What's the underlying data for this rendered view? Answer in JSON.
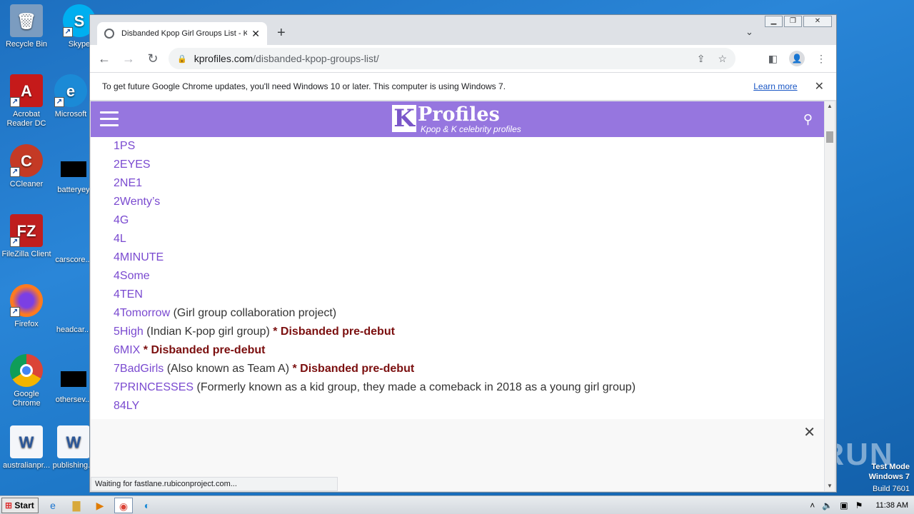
{
  "desktop": {
    "icons": [
      {
        "name": "recycle-bin",
        "label": "Recycle Bin",
        "glyph": "🗑",
        "color": "#6d8fb3"
      },
      {
        "name": "skype",
        "label": "Skype",
        "glyph": "S",
        "color": "#00aff0"
      },
      {
        "name": "acrobat",
        "label": "Acrobat Reader DC",
        "glyph": "A",
        "color": "#c51a1a"
      },
      {
        "name": "edge",
        "label": "Microsoft",
        "glyph": "e",
        "color": "#1b8ad6"
      },
      {
        "name": "ccleaner",
        "label": "CCleaner",
        "glyph": "C",
        "color": "#c43a25"
      },
      {
        "name": "batteryey",
        "label": "batteryey"
      },
      {
        "name": "filezilla",
        "label": "FileZilla Client",
        "glyph": "FZ",
        "color": "#bf1e1e"
      },
      {
        "name": "carscore",
        "label": "carscore..."
      },
      {
        "name": "firefox",
        "label": "Firefox",
        "glyph": "●",
        "color": "#ff7a1f"
      },
      {
        "name": "headcar",
        "label": "headcar..."
      },
      {
        "name": "chrome",
        "label": "Google Chrome",
        "glyph": "◉",
        "color": "#3b8a3e"
      },
      {
        "name": "othersev",
        "label": "othersev..."
      },
      {
        "name": "australianpr",
        "label": "australianpr...",
        "glyph": "W",
        "color": "#2b579a"
      },
      {
        "name": "publishing",
        "label": "publishing...",
        "glyph": "W",
        "color": "#2b579a"
      }
    ],
    "watermark": {
      "line1": "Test Mode",
      "line2": "Windows 7",
      "line3": "Build 7601",
      "brand": "ANY RUN"
    }
  },
  "browser": {
    "tab_title": "Disbanded Kpop Girl Groups List - Kp",
    "url_host": "kprofiles.com",
    "url_path": "/disbanded-kpop-groups-list/",
    "infobar_text": "To get future Google Chrome updates, you'll need Windows 10 or later. This computer is using Windows 7.",
    "infobar_link": "Learn more",
    "status_text": "Waiting for fastlane.rubiconproject.com..."
  },
  "site": {
    "logo_k": "K",
    "logo_name": "Profiles",
    "logo_tagline": "Kpop & K celebrity profiles",
    "header_color": "#9676df",
    "groups": [
      {
        "name": "1PS",
        "note": "",
        "status": ""
      },
      {
        "name": "2EYES",
        "note": "",
        "status": ""
      },
      {
        "name": "2NE1",
        "note": "",
        "status": ""
      },
      {
        "name": "2Wenty’s",
        "note": "",
        "status": ""
      },
      {
        "name": "4G",
        "note": "",
        "status": ""
      },
      {
        "name": "4L",
        "note": "",
        "status": ""
      },
      {
        "name": "4MINUTE",
        "note": "",
        "status": ""
      },
      {
        "name": "4Some",
        "note": "",
        "status": ""
      },
      {
        "name": "4TEN",
        "note": "",
        "status": ""
      },
      {
        "name": "4Tomorrow",
        "note": " (Girl group collaboration project)",
        "status": ""
      },
      {
        "name": "5High",
        "note": " (Indian K-pop girl group) ",
        "status": "* Disbanded pre-debut"
      },
      {
        "name": "6MIX",
        "note": " ",
        "status": "* Disbanded pre-debut"
      },
      {
        "name": "7BadGirls",
        "note": " (Also known as Team A) ",
        "status": "* Disbanded pre-debut"
      },
      {
        "name": "7PRINCESSES",
        "note": " (Formerly known as a kid group, they made a comeback in 2018 as a young girl group)",
        "status": ""
      },
      {
        "name": "84LY",
        "note": "",
        "status": ""
      }
    ]
  },
  "taskbar": {
    "start_label": "Start",
    "clock": "11:38 AM"
  }
}
